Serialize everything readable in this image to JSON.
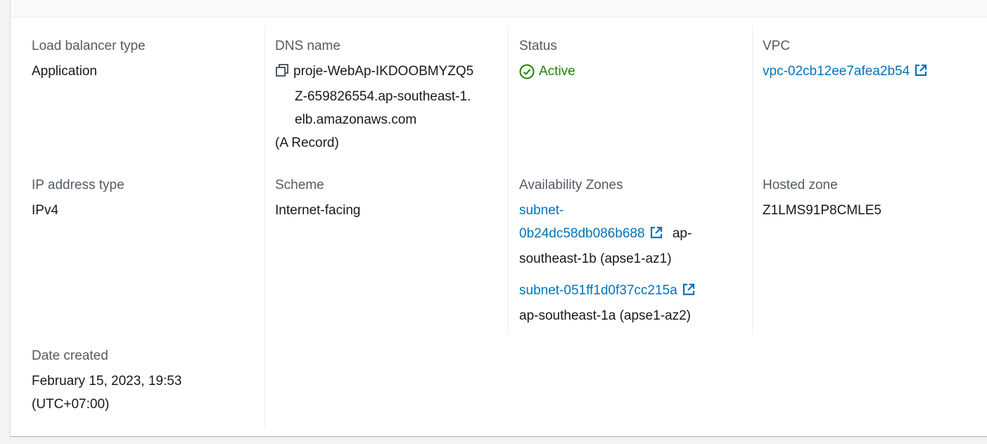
{
  "details": {
    "load_balancer_type": {
      "label": "Load balancer type",
      "value": "Application"
    },
    "dns_name": {
      "label": "DNS name",
      "lines": [
        "proje-WebAp-IKDOOBMYZQ5",
        "Z-659826554.ap-southeast-1.",
        "elb.amazonaws.com"
      ],
      "record": "(A Record)",
      "copy_icon": "copy-icon"
    },
    "status": {
      "label": "Status",
      "value": "Active",
      "icon": "check-circle-icon",
      "color": "#1d8102"
    },
    "vpc": {
      "label": "VPC",
      "value": "vpc-02cb12ee7afea2b54",
      "icon": "external-link-icon"
    },
    "ip_address_type": {
      "label": "IP address type",
      "value": "IPv4"
    },
    "scheme": {
      "label": "Scheme",
      "value": "Internet-facing"
    },
    "availability_zones": {
      "label": "Availability Zones",
      "zones": [
        {
          "subnet_line1": "subnet-",
          "subnet_line2": "0b24dc58db086b688",
          "zone_inline": "ap-",
          "zone_rest": "southeast-1b (apse1-az1)"
        },
        {
          "subnet": "subnet-051ff1d0f37cc215a",
          "zone": "ap-southeast-1a (apse1-az2)"
        }
      ]
    },
    "hosted_zone": {
      "label": "Hosted zone",
      "value": "Z1LMS91P8CMLE5"
    },
    "date_created": {
      "label": "Date created",
      "lines": [
        "February 15, 2023, 19:53",
        "(UTC+07:00)"
      ]
    }
  },
  "colors": {
    "link": "#0073bb",
    "label": "#545b64",
    "text": "#16191f",
    "success": "#1d8102"
  }
}
